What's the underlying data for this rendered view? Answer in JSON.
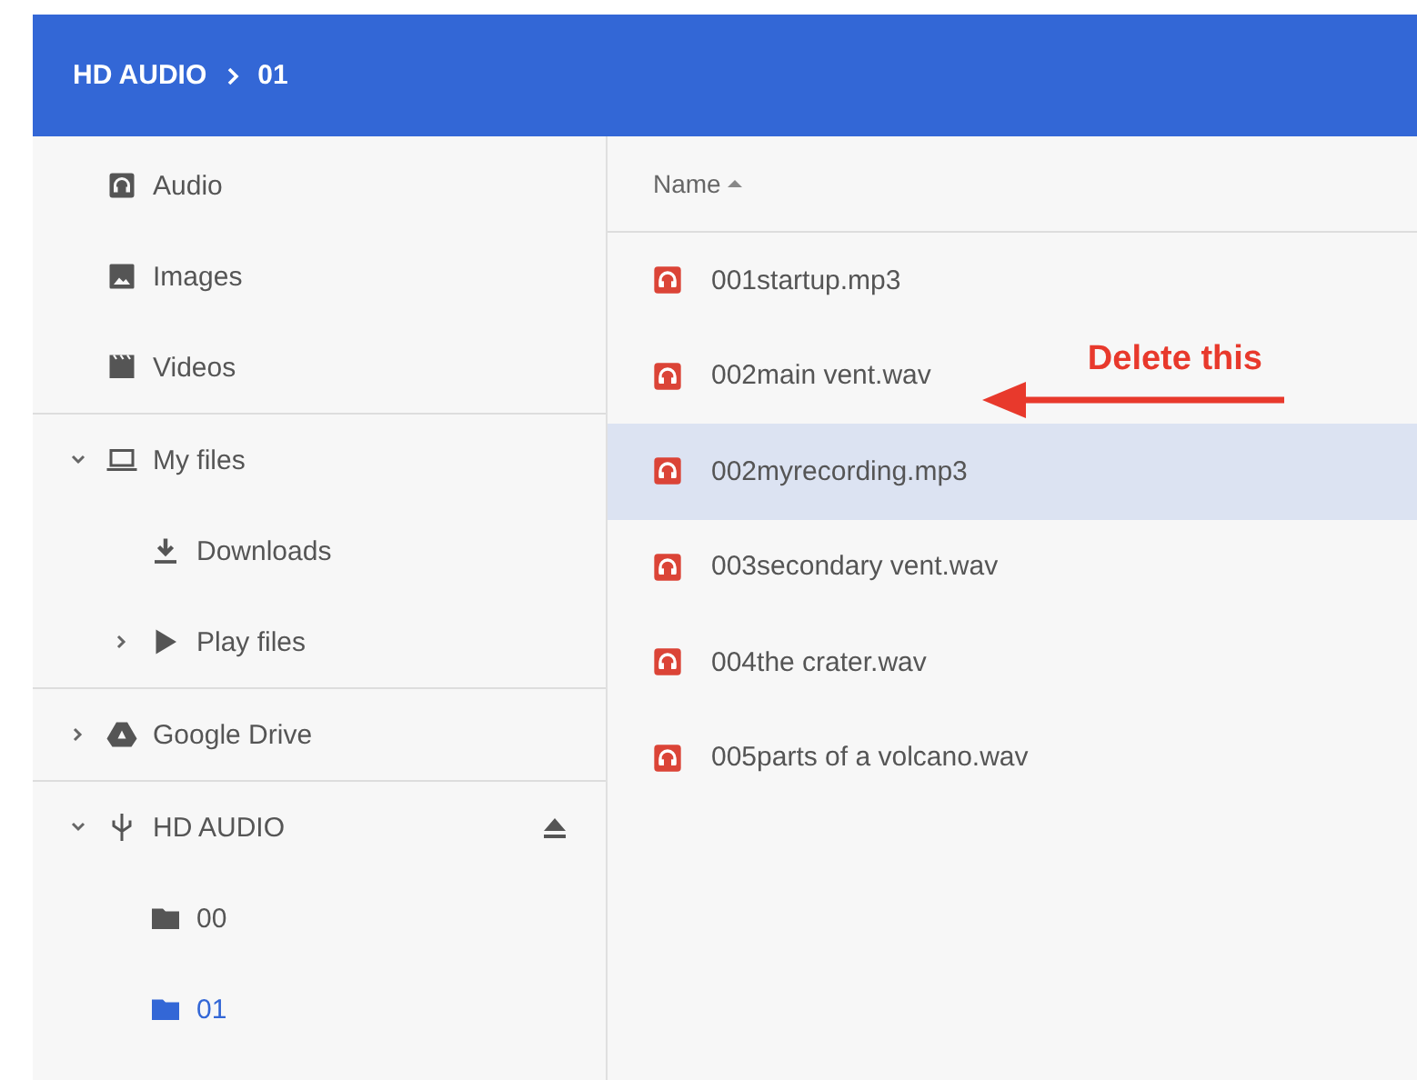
{
  "breadcrumb": [
    "HD AUDIO",
    "01"
  ],
  "sidebar": {
    "sections": [
      {
        "items": [
          {
            "label": "Audio",
            "kind": "audio",
            "selected": false
          },
          {
            "label": "Images",
            "kind": "image",
            "selected": false
          },
          {
            "label": "Videos",
            "kind": "video",
            "selected": false
          }
        ]
      },
      {
        "items": [
          {
            "label": "My files",
            "kind": "laptop",
            "expanded": true,
            "selected": false,
            "children": [
              {
                "label": "Downloads",
                "kind": "download",
                "selected": false
              },
              {
                "label": "Play files",
                "kind": "play",
                "expanded": false,
                "selected": false
              }
            ]
          }
        ]
      },
      {
        "items": [
          {
            "label": "Google Drive",
            "kind": "drive",
            "expanded": false,
            "selected": false
          }
        ]
      },
      {
        "items": [
          {
            "label": "HD AUDIO",
            "kind": "usb",
            "expanded": true,
            "eject": true,
            "selected": false,
            "children": [
              {
                "label": "00",
                "kind": "folder",
                "selected": false
              },
              {
                "label": "01",
                "kind": "folder",
                "selected": true
              }
            ]
          }
        ]
      }
    ]
  },
  "table": {
    "columns": [
      "Name"
    ],
    "sorted_ascending": true,
    "rows": [
      {
        "name": "001startup.mp3",
        "selected": false
      },
      {
        "name": "002main vent.wav",
        "selected": false,
        "annotation": "Delete this"
      },
      {
        "name": "002myrecording.mp3",
        "selected": true
      },
      {
        "name": "003secondary vent.wav",
        "selected": false
      },
      {
        "name": "004the crater.wav",
        "selected": false
      },
      {
        "name": "005parts of a volcano.wav",
        "selected": false
      }
    ]
  }
}
